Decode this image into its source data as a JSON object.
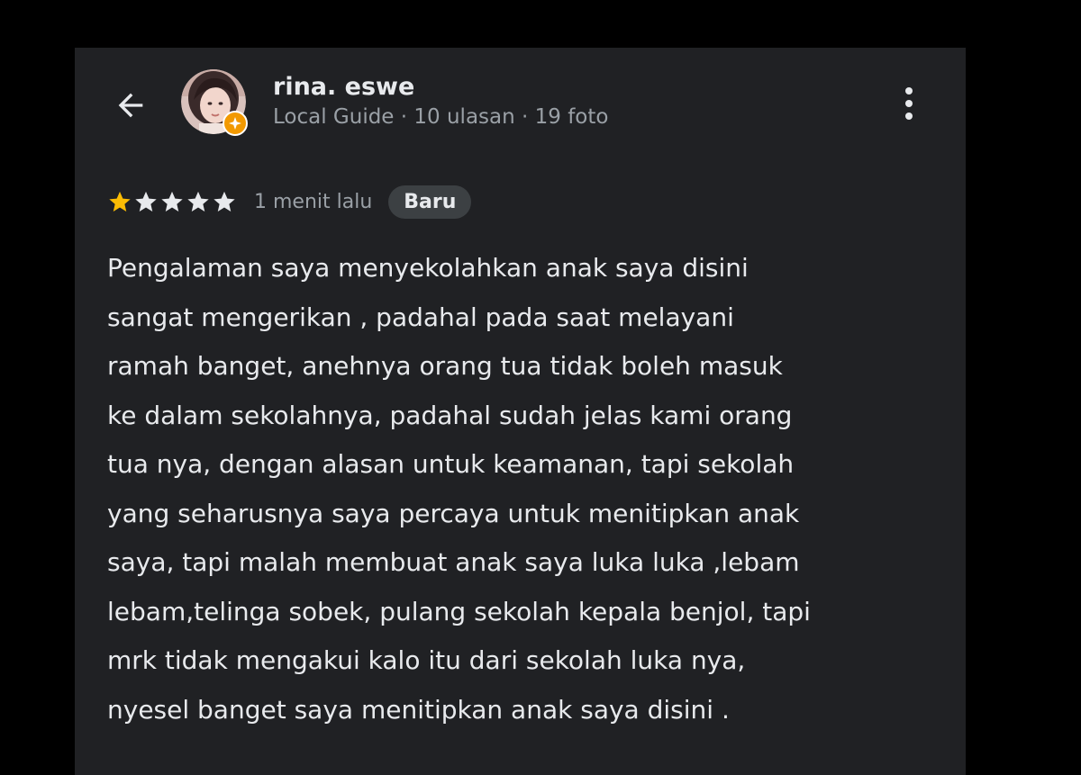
{
  "header": {
    "back_icon": "arrow-back-icon",
    "more_icon": "more-vertical-icon"
  },
  "user": {
    "name": "rina. eswe",
    "meta": "Local Guide · 10 ulasan · 19 foto",
    "avatar_icon": "avatar-photo",
    "badge_icon": "local-guide-badge-icon"
  },
  "review": {
    "rating": 1,
    "max_rating": 5,
    "time": "1 menit lalu",
    "badge": "Baru",
    "lines": [
      "Pengalaman saya menyekolahkan anak saya disini",
      "sangat mengerikan , padahal pada saat melayani",
      "ramah banget, anehnya orang tua tidak boleh masuk",
      "ke dalam sekolahnya, padahal sudah jelas kami orang",
      "tua nya, dengan alasan untuk keamanan, tapi sekolah",
      "yang seharusnya saya percaya untuk menitipkan anak",
      "saya, tapi malah membuat anak saya luka luka ,lebam",
      "lebam,telinga sobek, pulang sekolah kepala benjol, tapi",
      "mrk tidak mengakui kalo itu dari sekolah luka nya,",
      "nyesel banget saya menitipkan anak saya disini ."
    ]
  },
  "colors": {
    "background": "#202124",
    "outer": "#000000",
    "text_primary": "#e8eaed",
    "text_secondary": "#9aa0a6",
    "star_filled": "#fbbc04",
    "star_empty": "#e8eaed",
    "badge_bg": "#3c4043",
    "guide_badge": "#f29900"
  }
}
